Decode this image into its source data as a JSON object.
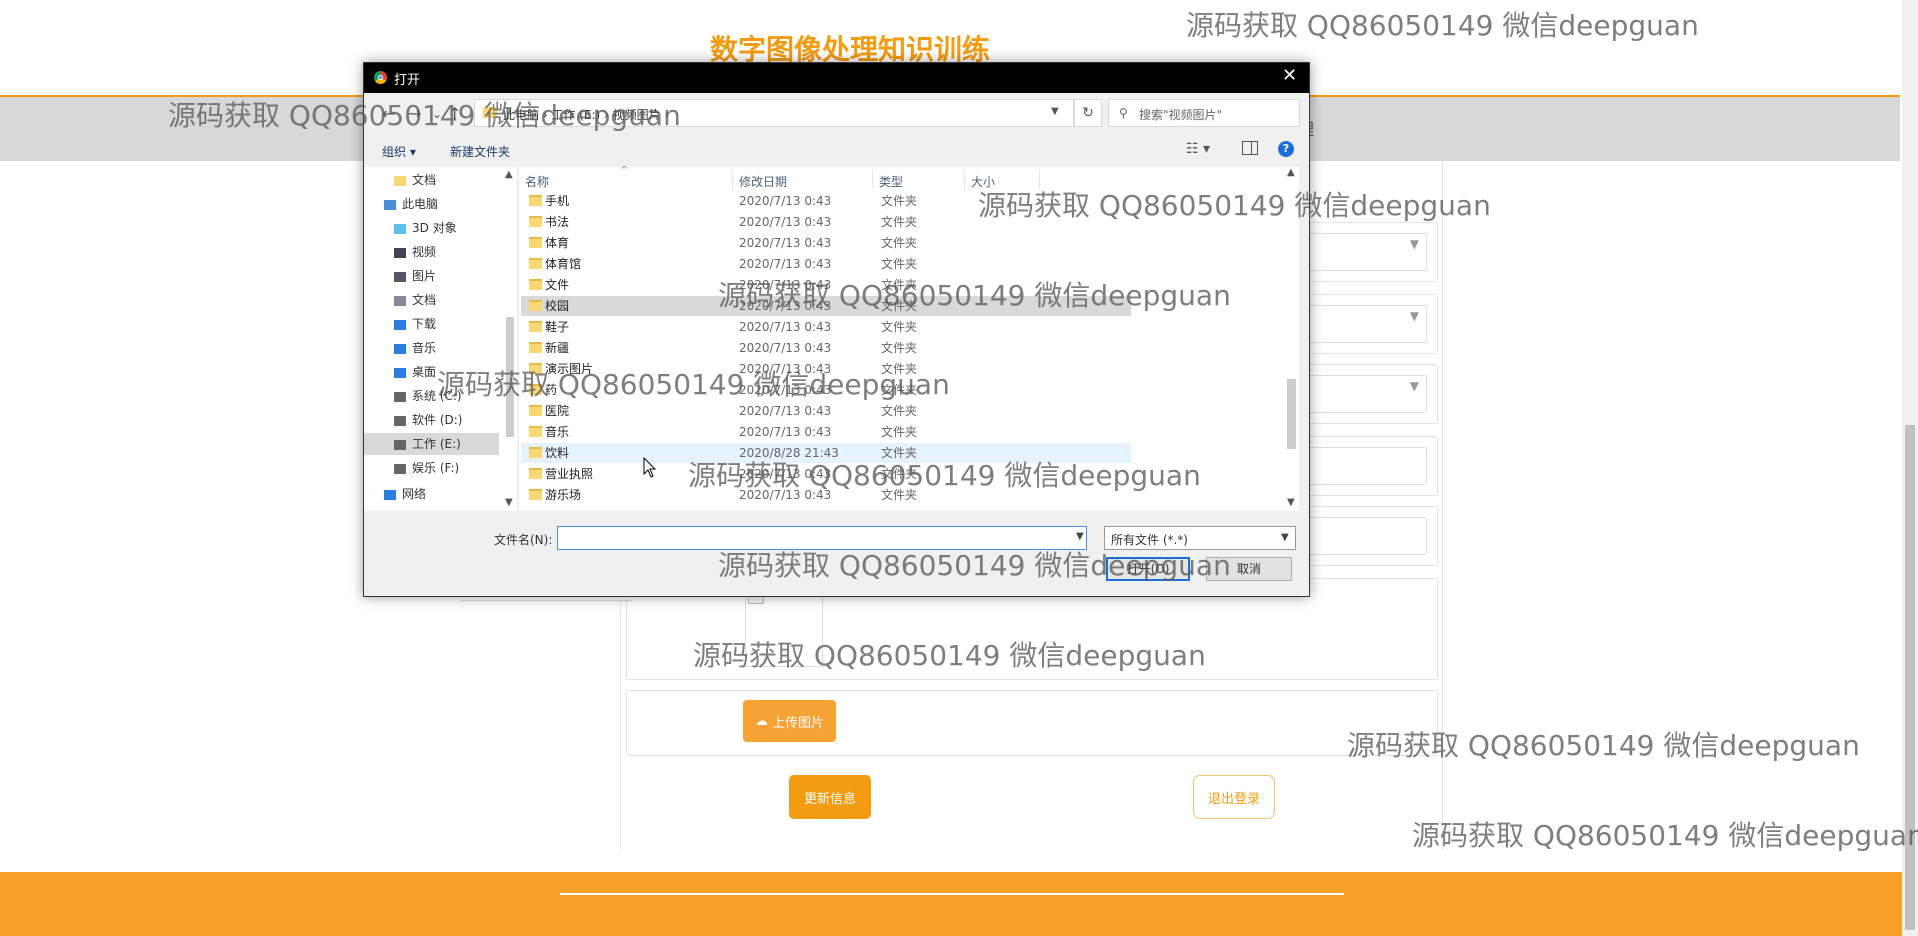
{
  "site": {
    "title": "数字图像处理知识训练",
    "nav_tail": "理"
  },
  "page": {
    "upload_label": "上传图片",
    "update_label": "更新信息",
    "logout_label": "退出登录",
    "brand_color": "#f39c12"
  },
  "dialog": {
    "title": "打开",
    "close": "✕",
    "path": "此电脑 › 工作 (E:) › 视频图片 ›",
    "refresh": "↻",
    "search_placeholder": "搜索\"视频图片\"",
    "organize": "组织 ▾",
    "new_folder": "新建文件夹",
    "help": "?",
    "columns": [
      "名称",
      "修改日期",
      "类型",
      "大小"
    ],
    "nav_items": [
      {
        "label": "文档",
        "icon": "folder-icon"
      },
      {
        "label": "此电脑",
        "icon": "computer-icon"
      },
      {
        "label": "3D 对象",
        "icon": "cube-icon"
      },
      {
        "label": "视频",
        "icon": "video-icon"
      },
      {
        "label": "图片",
        "icon": "picture-icon"
      },
      {
        "label": "文档",
        "icon": "document-icon"
      },
      {
        "label": "下载",
        "icon": "download-icon"
      },
      {
        "label": "音乐",
        "icon": "music-icon"
      },
      {
        "label": "桌面",
        "icon": "desktop-icon"
      },
      {
        "label": "系统 (C:)",
        "icon": "drive-icon"
      },
      {
        "label": "软件 (D:)",
        "icon": "drive-icon"
      },
      {
        "label": "工作 (E:)",
        "icon": "drive-icon"
      },
      {
        "label": "娱乐 (F:)",
        "icon": "drive-icon"
      },
      {
        "label": "网络",
        "icon": "network-icon"
      }
    ],
    "files": [
      {
        "name": "手机",
        "date": "2020/7/13 0:43",
        "type": "文件夹"
      },
      {
        "name": "书法",
        "date": "2020/7/13 0:43",
        "type": "文件夹"
      },
      {
        "name": "体育",
        "date": "2020/7/13 0:43",
        "type": "文件夹"
      },
      {
        "name": "体育馆",
        "date": "2020/7/13 0:43",
        "type": "文件夹"
      },
      {
        "name": "文件",
        "date": "2020/7/13 0:43",
        "type": "文件夹"
      },
      {
        "name": "校园",
        "date": "2020/7/13 0:43",
        "type": "文件夹"
      },
      {
        "name": "鞋子",
        "date": "2020/7/13 0:43",
        "type": "文件夹"
      },
      {
        "name": "新疆",
        "date": "2020/7/13 0:43",
        "type": "文件夹"
      },
      {
        "name": "演示图片",
        "date": "2020/7/13 0:43",
        "type": "文件夹"
      },
      {
        "name": "药",
        "date": "2020/7/13 0:43",
        "type": "文件夹"
      },
      {
        "name": "医院",
        "date": "2020/7/13 0:43",
        "type": "文件夹"
      },
      {
        "name": "音乐",
        "date": "2020/7/13 0:43",
        "type": "文件夹"
      },
      {
        "name": "饮料",
        "date": "2020/8/28 21:43",
        "type": "文件夹"
      },
      {
        "name": "营业执照",
        "date": "2020/7/13 0:43",
        "type": "文件夹"
      },
      {
        "name": "游乐场",
        "date": "2020/7/13 0:43",
        "type": "文件夹"
      }
    ],
    "filename_label": "文件名(N):",
    "filename_value": "",
    "filter": "所有文件 (*.*)",
    "open_label": "打开(O)",
    "cancel_label": "取消"
  },
  "watermark": "源码获取 QQ86050149 微信deepguan"
}
